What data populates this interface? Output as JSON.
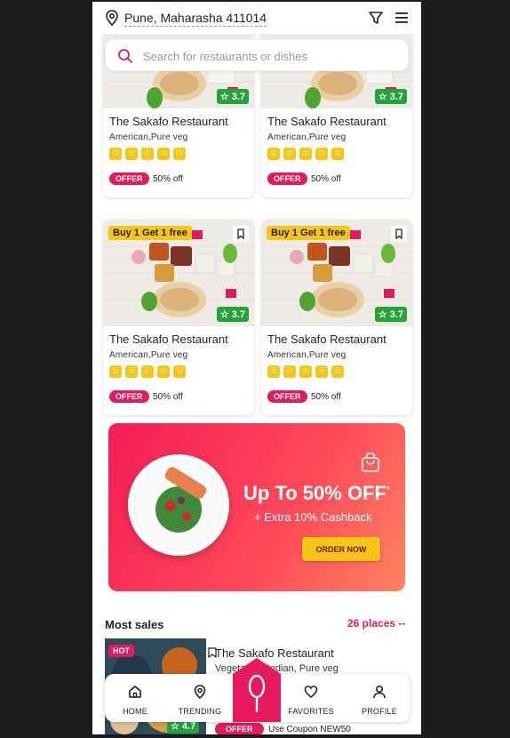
{
  "header": {
    "location": "Pune, Maharasha 411014",
    "location_icon": "location-pin-icon",
    "filter_icon": "filter-icon",
    "menu_icon": "hamburger-menu-icon"
  },
  "search": {
    "placeholder": "Search for restaurants or dishes"
  },
  "restaurants": [
    {
      "promo": "",
      "name": "The Sakafo Restaurant",
      "cuisine": "American,Pure veg",
      "rating": "3.7",
      "stars": 5,
      "offer_tag": "OFFER",
      "offer_text": "50% off"
    },
    {
      "promo": "",
      "name": "The Sakafo Restaurant",
      "cuisine": "American,Pure veg",
      "rating": "3.7",
      "stars": 5,
      "offer_tag": "OFFER",
      "offer_text": "50% off"
    },
    {
      "promo": "Buy 1 Get 1 free",
      "name": "The Sakafo Restaurant",
      "cuisine": "American,Pure veg",
      "rating": "3.7",
      "stars": 5,
      "offer_tag": "OFFER",
      "offer_text": "50% off"
    },
    {
      "promo": "Buy 1 Get 1 free",
      "name": "The Sakafo Restaurant",
      "cuisine": "American,Pure veg",
      "rating": "3.7",
      "stars": 5,
      "offer_tag": "OFFER",
      "offer_text": "50% off"
    }
  ],
  "banner": {
    "title": "Up To 50% OFF",
    "title_mark": "*",
    "subtitle": "+ Extra 10% Cashback",
    "button": "ORDER NOW",
    "colors": {
      "start": "#f51c56",
      "end": "#ff8460",
      "button": "#f7c514"
    }
  },
  "most_sales": {
    "title": "Most sales",
    "link": "26 places --",
    "item": {
      "badge": "HOT",
      "name": "The Sakafo Restaurant",
      "cuisine": "Vegetarian, Indian, Pure veg",
      "rating": "4.7",
      "offer_tag": "OFFER",
      "coupon": "Use Coupon NEW50"
    }
  },
  "nav": {
    "items": [
      {
        "label": "HOME",
        "icon": "home-icon"
      },
      {
        "label": "TRENDING",
        "icon": "location-pin-icon"
      },
      {
        "label": "FAVORITES",
        "icon": "heart-icon"
      },
      {
        "label": "PROFILE",
        "icon": "user-icon"
      }
    ],
    "center_icon": "spoon-icon"
  },
  "colors": {
    "accent": "#e5195c",
    "rating": "#24a339",
    "star": "#f7c514"
  }
}
